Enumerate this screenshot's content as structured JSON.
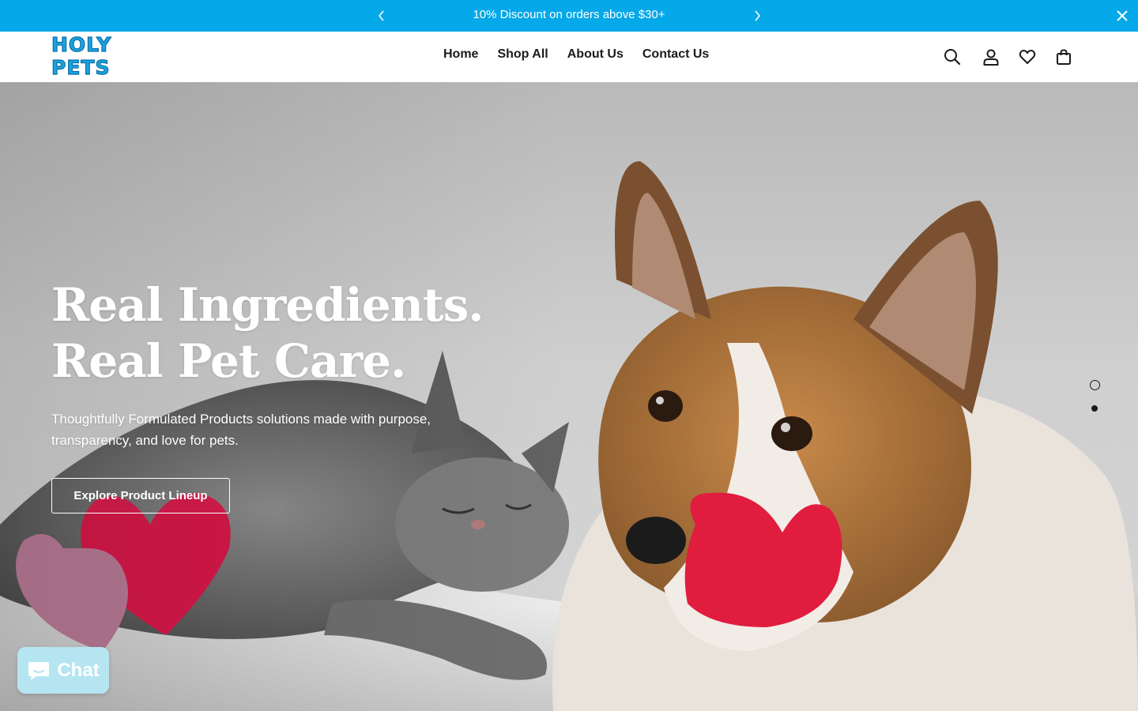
{
  "announcement": {
    "text": "10% Discount on orders above $30+",
    "background": "#05a8e8"
  },
  "brand": {
    "logo_text": "HOLY PETS",
    "color": "#1aa3e0"
  },
  "nav": {
    "items": [
      {
        "label": "Home"
      },
      {
        "label": "Shop All"
      },
      {
        "label": "About Us"
      },
      {
        "label": "Contact Us"
      }
    ]
  },
  "header_icons": [
    "search-icon",
    "account-icon",
    "wishlist-icon",
    "cart-icon"
  ],
  "hero": {
    "headline_line1": "Real Ingredients.",
    "headline_line2": "Real Pet Care.",
    "subtitle_line1": "Thoughtfully Formulated Products solutions made with purpose,",
    "subtitle_line2": "transparency, and love for pets.",
    "cta_label": "Explore Product Lineup",
    "slides_total": 2,
    "active_slide": 2
  },
  "chat": {
    "label": "Chat",
    "background": "#b6e5f2"
  }
}
